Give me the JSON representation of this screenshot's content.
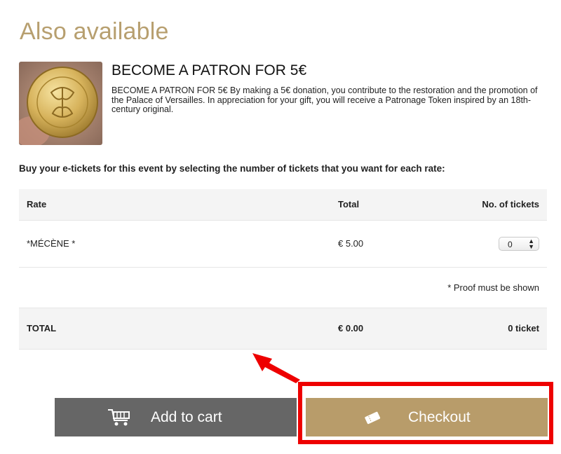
{
  "section": {
    "heading": "Also available"
  },
  "product": {
    "title": "BECOME A PATRON FOR 5€",
    "description": "BECOME A PATRON FOR 5€ By making a 5€ donation, you contribute to the restoration and the promotion of the Palace of Versailles. In appreciation for your gift, you will receive a Patronage Token inspired by an 18th-century original."
  },
  "instructions": "Buy your e-tickets for this event by selecting the number of tickets that you want for each rate:",
  "table": {
    "headers": {
      "rate": "Rate",
      "total": "Total",
      "tickets": "No. of tickets"
    },
    "rows": [
      {
        "rate": "*MÉCÈNE *",
        "price": "€ 5.00",
        "quantity": "0"
      }
    ],
    "note": "* Proof must be shown",
    "total": {
      "label": "TOTAL",
      "amount": "€ 0.00",
      "tickets": "0 ticket"
    }
  },
  "buttons": {
    "add_to_cart": "Add to cart",
    "checkout": "Checkout"
  },
  "colors": {
    "heading": "#b79f6f",
    "checkout_bg": "#b89c6a",
    "cart_bg": "#666666",
    "highlight": "#ee0000"
  },
  "icons": {
    "cart": "shopping-cart-icon",
    "checkout": "ticket-icon",
    "select": "chevron-updown-icon",
    "pointer": "arrow-pointer-icon"
  }
}
